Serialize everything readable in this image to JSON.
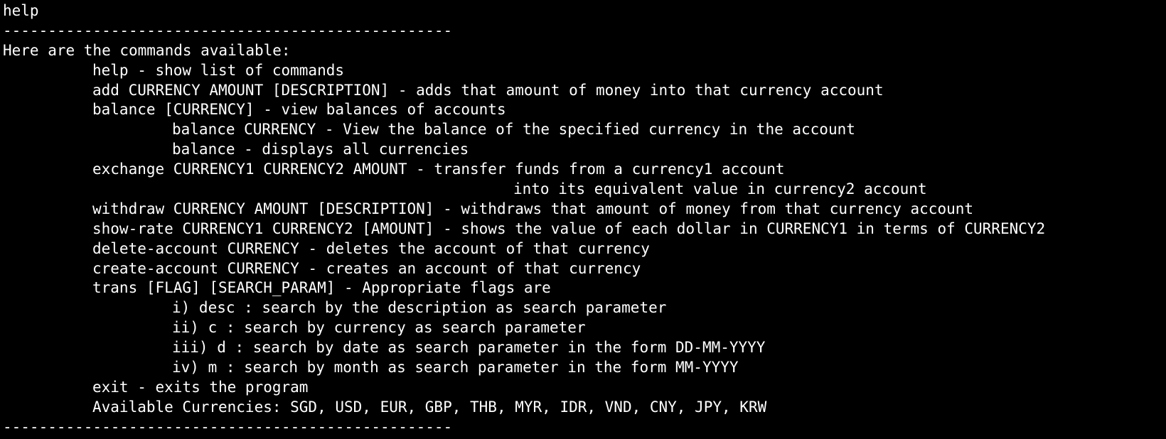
{
  "terminal": {
    "command": "help",
    "separator": "--------------------------------------------------",
    "intro": "Here are the commands available:",
    "commands": {
      "help": "help - show list of commands",
      "add": "add CURRENCY AMOUNT [DESCRIPTION] - adds that amount of money into that currency account",
      "balance": "balance [CURRENCY] - view balances of accounts",
      "balance_currency": "balance CURRENCY - View the balance of the specified currency in the account",
      "balance_all": "balance - displays all currencies",
      "exchange": "exchange CURRENCY1 CURRENCY2 AMOUNT - transfer funds from a currency1 account",
      "exchange_cont": "into its equivalent value in currency2 account",
      "withdraw": "withdraw CURRENCY AMOUNT [DESCRIPTION] - withdraws that amount of money from that currency account",
      "show_rate": "show-rate CURRENCY1 CURRENCY2 [AMOUNT] - shows the value of each dollar in CURRENCY1 in terms of CURRENCY2",
      "delete_account": "delete-account CURRENCY - deletes the account of that currency",
      "create_account": "create-account CURRENCY - creates an account of that currency",
      "trans": "trans [FLAG] [SEARCH_PARAM] - Appropriate flags are",
      "trans_flags": [
        "i) desc : search by the description as search parameter",
        "ii) c : search by currency as search parameter",
        "iii) d : search by date as search parameter in the form DD-MM-YYYY",
        "iv) m : search by month as search parameter in the form MM-YYYY"
      ],
      "exit": "exit - exits the program"
    },
    "currencies_line": "Available Currencies: SGD, USD, EUR, GBP, THB, MYR, IDR, VND, CNY, JPY, KRW",
    "separator_bottom": "--------------------------------------------------"
  }
}
